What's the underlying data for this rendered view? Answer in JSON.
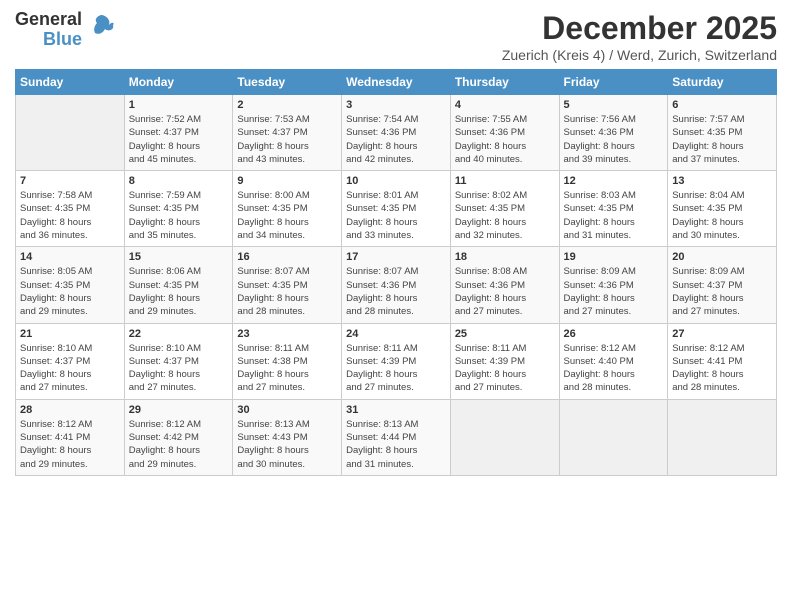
{
  "logo": {
    "part1": "General",
    "part2": "Blue"
  },
  "title": "December 2025",
  "subtitle": "Zuerich (Kreis 4) / Werd, Zurich, Switzerland",
  "weekdays": [
    "Sunday",
    "Monday",
    "Tuesday",
    "Wednesday",
    "Thursday",
    "Friday",
    "Saturday"
  ],
  "weeks": [
    [
      {
        "day": "",
        "info": ""
      },
      {
        "day": "1",
        "info": "Sunrise: 7:52 AM\nSunset: 4:37 PM\nDaylight: 8 hours\nand 45 minutes."
      },
      {
        "day": "2",
        "info": "Sunrise: 7:53 AM\nSunset: 4:37 PM\nDaylight: 8 hours\nand 43 minutes."
      },
      {
        "day": "3",
        "info": "Sunrise: 7:54 AM\nSunset: 4:36 PM\nDaylight: 8 hours\nand 42 minutes."
      },
      {
        "day": "4",
        "info": "Sunrise: 7:55 AM\nSunset: 4:36 PM\nDaylight: 8 hours\nand 40 minutes."
      },
      {
        "day": "5",
        "info": "Sunrise: 7:56 AM\nSunset: 4:36 PM\nDaylight: 8 hours\nand 39 minutes."
      },
      {
        "day": "6",
        "info": "Sunrise: 7:57 AM\nSunset: 4:35 PM\nDaylight: 8 hours\nand 37 minutes."
      }
    ],
    [
      {
        "day": "7",
        "info": "Sunrise: 7:58 AM\nSunset: 4:35 PM\nDaylight: 8 hours\nand 36 minutes."
      },
      {
        "day": "8",
        "info": "Sunrise: 7:59 AM\nSunset: 4:35 PM\nDaylight: 8 hours\nand 35 minutes."
      },
      {
        "day": "9",
        "info": "Sunrise: 8:00 AM\nSunset: 4:35 PM\nDaylight: 8 hours\nand 34 minutes."
      },
      {
        "day": "10",
        "info": "Sunrise: 8:01 AM\nSunset: 4:35 PM\nDaylight: 8 hours\nand 33 minutes."
      },
      {
        "day": "11",
        "info": "Sunrise: 8:02 AM\nSunset: 4:35 PM\nDaylight: 8 hours\nand 32 minutes."
      },
      {
        "day": "12",
        "info": "Sunrise: 8:03 AM\nSunset: 4:35 PM\nDaylight: 8 hours\nand 31 minutes."
      },
      {
        "day": "13",
        "info": "Sunrise: 8:04 AM\nSunset: 4:35 PM\nDaylight: 8 hours\nand 30 minutes."
      }
    ],
    [
      {
        "day": "14",
        "info": "Sunrise: 8:05 AM\nSunset: 4:35 PM\nDaylight: 8 hours\nand 29 minutes."
      },
      {
        "day": "15",
        "info": "Sunrise: 8:06 AM\nSunset: 4:35 PM\nDaylight: 8 hours\nand 29 minutes."
      },
      {
        "day": "16",
        "info": "Sunrise: 8:07 AM\nSunset: 4:35 PM\nDaylight: 8 hours\nand 28 minutes."
      },
      {
        "day": "17",
        "info": "Sunrise: 8:07 AM\nSunset: 4:36 PM\nDaylight: 8 hours\nand 28 minutes."
      },
      {
        "day": "18",
        "info": "Sunrise: 8:08 AM\nSunset: 4:36 PM\nDaylight: 8 hours\nand 27 minutes."
      },
      {
        "day": "19",
        "info": "Sunrise: 8:09 AM\nSunset: 4:36 PM\nDaylight: 8 hours\nand 27 minutes."
      },
      {
        "day": "20",
        "info": "Sunrise: 8:09 AM\nSunset: 4:37 PM\nDaylight: 8 hours\nand 27 minutes."
      }
    ],
    [
      {
        "day": "21",
        "info": "Sunrise: 8:10 AM\nSunset: 4:37 PM\nDaylight: 8 hours\nand 27 minutes."
      },
      {
        "day": "22",
        "info": "Sunrise: 8:10 AM\nSunset: 4:37 PM\nDaylight: 8 hours\nand 27 minutes."
      },
      {
        "day": "23",
        "info": "Sunrise: 8:11 AM\nSunset: 4:38 PM\nDaylight: 8 hours\nand 27 minutes."
      },
      {
        "day": "24",
        "info": "Sunrise: 8:11 AM\nSunset: 4:39 PM\nDaylight: 8 hours\nand 27 minutes."
      },
      {
        "day": "25",
        "info": "Sunrise: 8:11 AM\nSunset: 4:39 PM\nDaylight: 8 hours\nand 27 minutes."
      },
      {
        "day": "26",
        "info": "Sunrise: 8:12 AM\nSunset: 4:40 PM\nDaylight: 8 hours\nand 28 minutes."
      },
      {
        "day": "27",
        "info": "Sunrise: 8:12 AM\nSunset: 4:41 PM\nDaylight: 8 hours\nand 28 minutes."
      }
    ],
    [
      {
        "day": "28",
        "info": "Sunrise: 8:12 AM\nSunset: 4:41 PM\nDaylight: 8 hours\nand 29 minutes."
      },
      {
        "day": "29",
        "info": "Sunrise: 8:12 AM\nSunset: 4:42 PM\nDaylight: 8 hours\nand 29 minutes."
      },
      {
        "day": "30",
        "info": "Sunrise: 8:13 AM\nSunset: 4:43 PM\nDaylight: 8 hours\nand 30 minutes."
      },
      {
        "day": "31",
        "info": "Sunrise: 8:13 AM\nSunset: 4:44 PM\nDaylight: 8 hours\nand 31 minutes."
      },
      {
        "day": "",
        "info": ""
      },
      {
        "day": "",
        "info": ""
      },
      {
        "day": "",
        "info": ""
      }
    ]
  ]
}
